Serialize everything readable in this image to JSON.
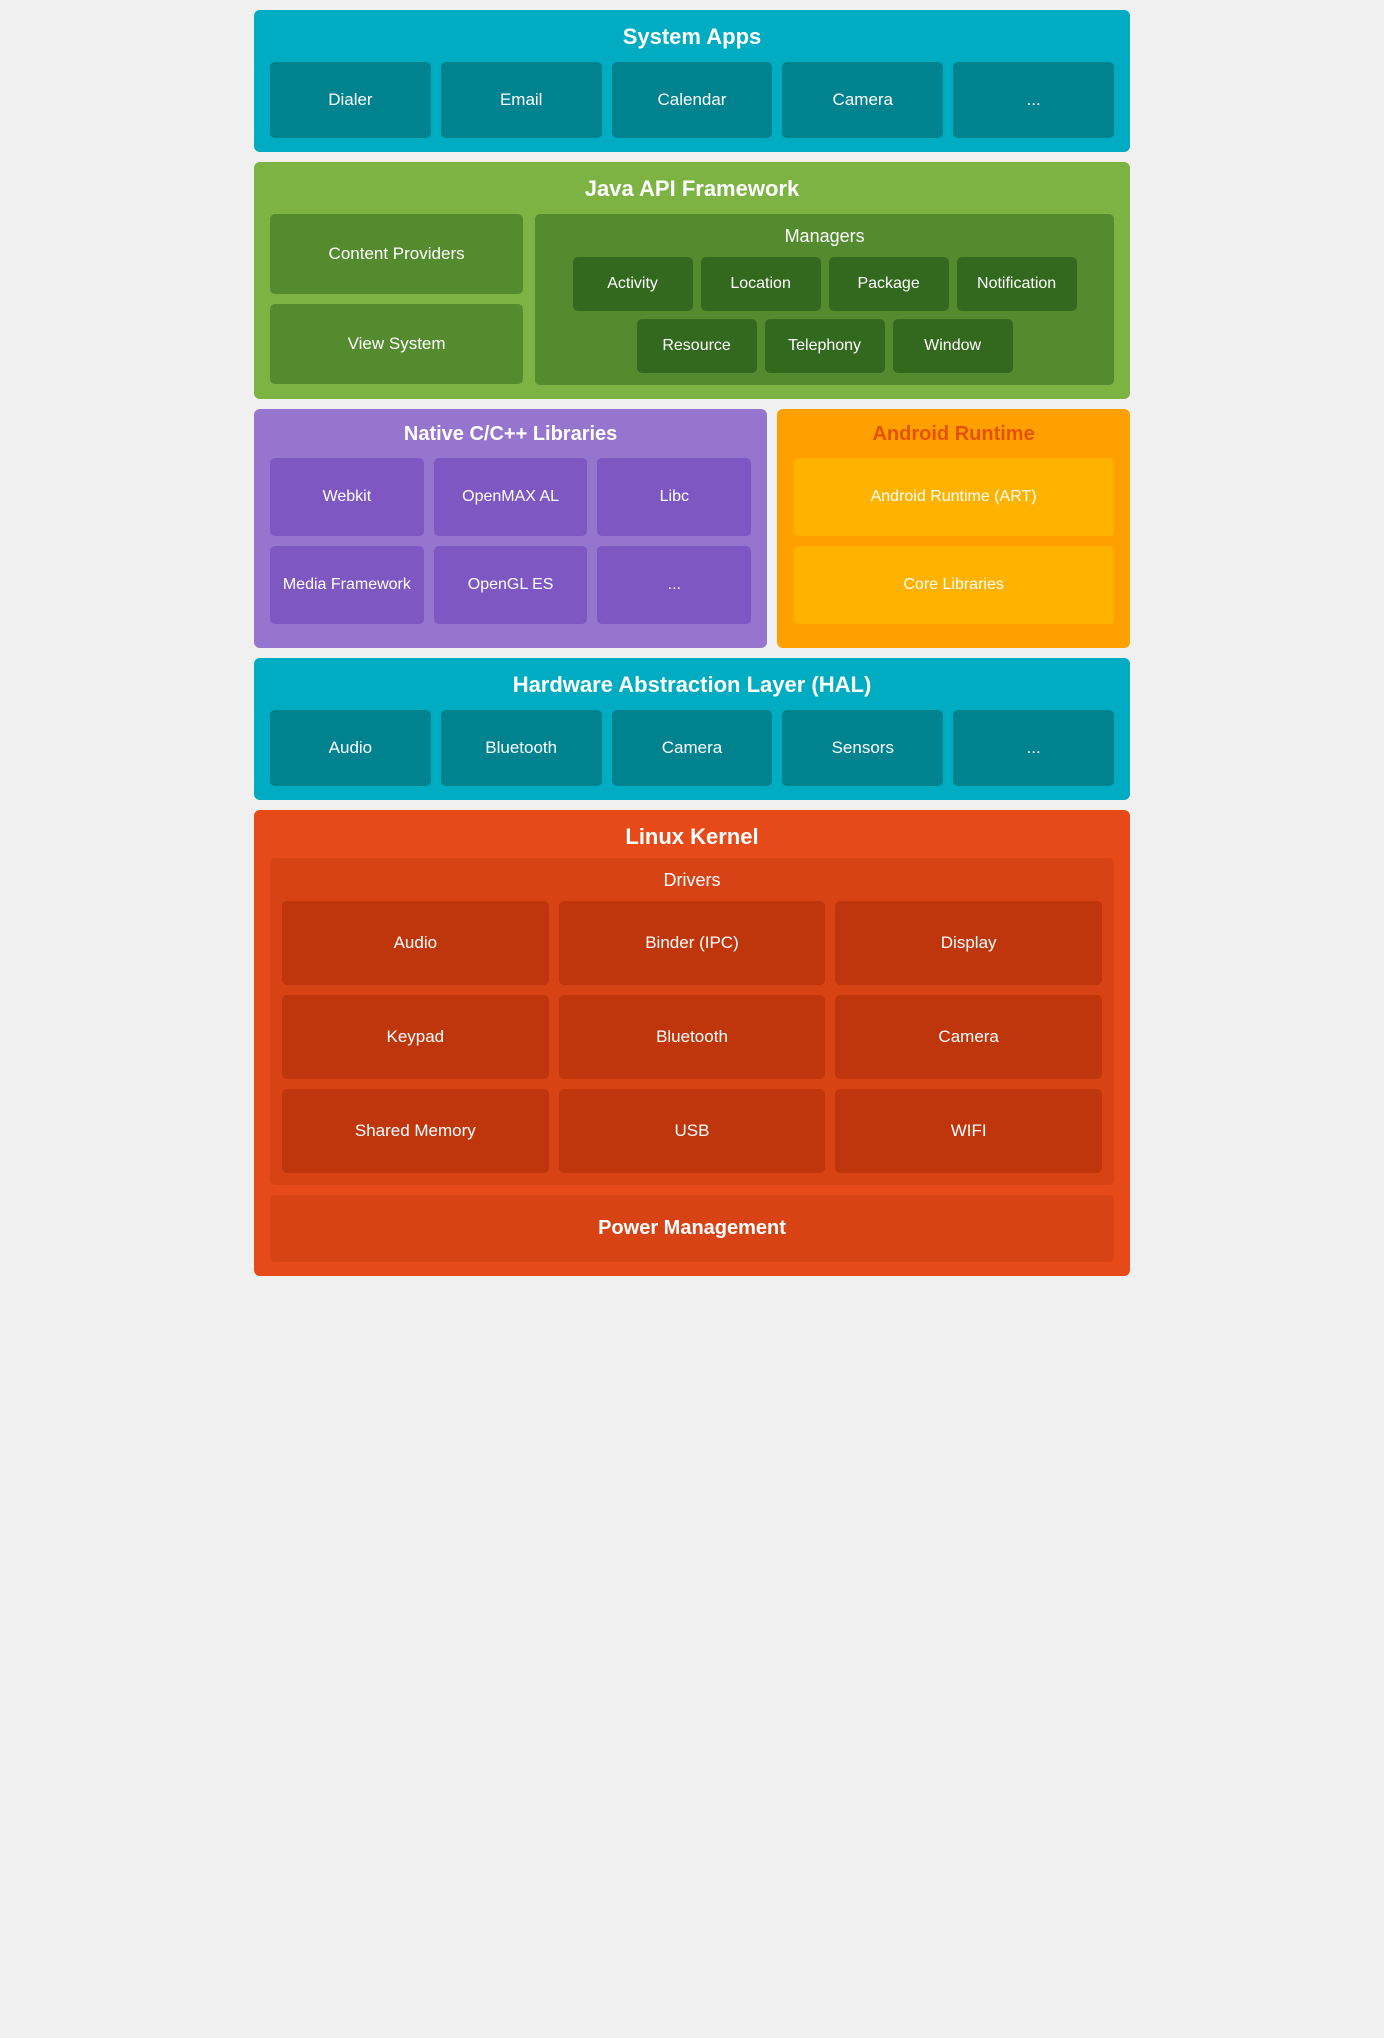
{
  "systemApps": {
    "title": "System Apps",
    "apps": [
      "Dialer",
      "Email",
      "Calendar",
      "Camera",
      "..."
    ]
  },
  "javaApi": {
    "title": "Java API Framework",
    "left": [
      "Content Providers",
      "View System"
    ],
    "managers": {
      "title": "Managers",
      "items": [
        "Activity",
        "Location",
        "Package",
        "Notification",
        "Resource",
        "Telephony",
        "Window"
      ]
    }
  },
  "nativeLibs": {
    "title": "Native C/C++ Libraries",
    "items": [
      "Webkit",
      "OpenMAX AL",
      "Libc",
      "Media Framework",
      "OpenGL ES",
      "..."
    ]
  },
  "androidRuntime": {
    "title": "Android Runtime",
    "items": [
      "Android Runtime (ART)",
      "Core Libraries"
    ]
  },
  "hal": {
    "title": "Hardware Abstraction Layer (HAL)",
    "items": [
      "Audio",
      "Bluetooth",
      "Camera",
      "Sensors",
      "..."
    ]
  },
  "linuxKernel": {
    "title": "Linux Kernel",
    "drivers": {
      "title": "Drivers",
      "items": [
        "Audio",
        "Binder (IPC)",
        "Display",
        "Keypad",
        "Bluetooth",
        "Camera",
        "Shared Memory",
        "USB",
        "WIFI"
      ]
    },
    "powerManagement": "Power Management"
  }
}
